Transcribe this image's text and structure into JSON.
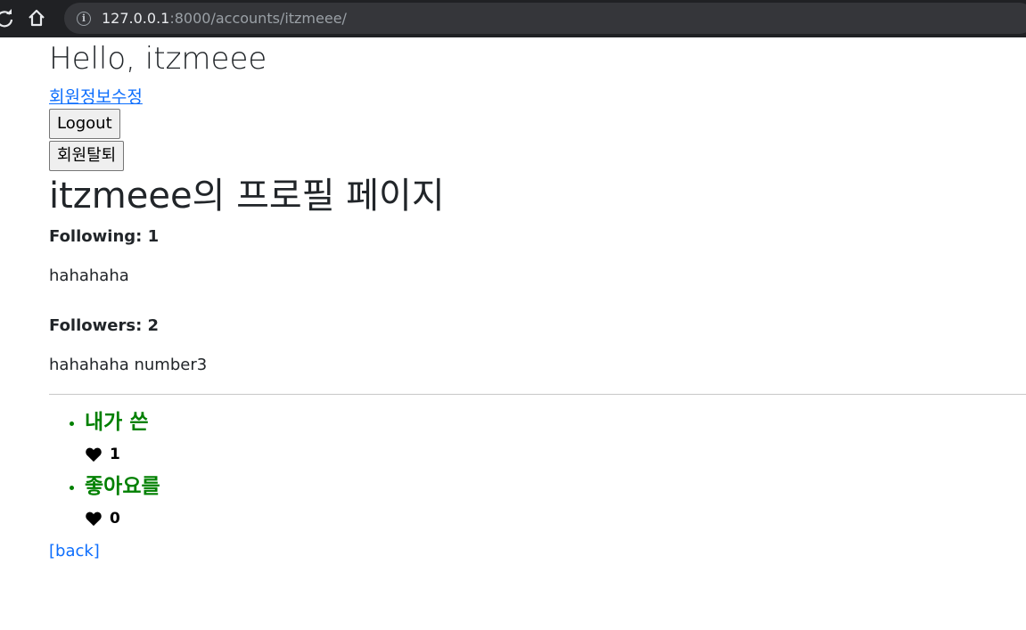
{
  "browser": {
    "url_host": "127.0.0.1",
    "url_rest": ":8000/accounts/itzmeee/"
  },
  "page": {
    "greeting": "Hello, itzmeee",
    "edit_link": "회원정보수정",
    "logout_label": "Logout",
    "withdraw_label": "회원탈퇴",
    "profile_title": "itzmeee의 프로필 페이지",
    "following_label": "Following: 1",
    "following_names": "hahahaha",
    "followers_label": "Followers: 2",
    "followers_names": "hahahaha number3",
    "posts": [
      {
        "title": "내가 쓴",
        "likes": "1"
      },
      {
        "title": "좋아요를",
        "likes": "0"
      }
    ],
    "back_link": "[back]"
  },
  "colors": {
    "post_title": "#008000",
    "link": "#0d6efd"
  }
}
